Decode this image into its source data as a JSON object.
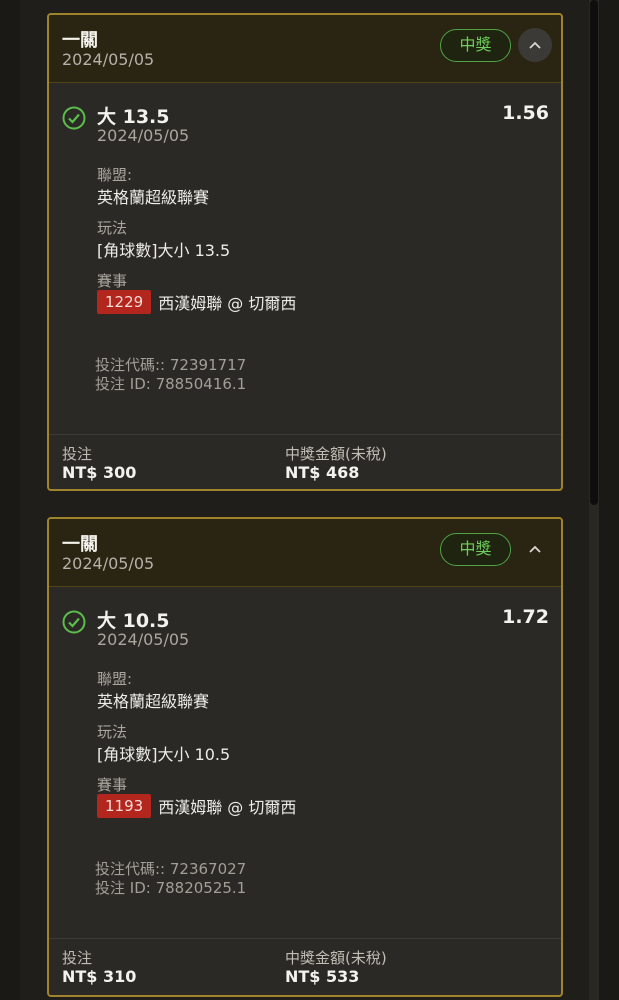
{
  "colors": {
    "card_border": "#a0842c",
    "win_green": "#6fce5c",
    "event_code_red": "#b3261e",
    "header_bg": "#2a2413"
  },
  "bets": [
    {
      "type": "一關",
      "date": "2024/05/05",
      "status": "中獎",
      "collapse_icon": "chevron-up-icon",
      "selection": "大 13.5",
      "selection_date": "2024/05/05",
      "odds": "1.56",
      "league_label": "聯盟:",
      "league": "英格蘭超級聯賽",
      "market_label": "玩法",
      "market": "[角球數]大小 13.5",
      "event_label": "賽事",
      "event_code": "1229",
      "event_name": "西漢姆聯 @ 切爾西",
      "bet_code": "投注代碼:: 72391717",
      "bet_id": "投注 ID: 78850416.1",
      "stake_label": "投注",
      "stake": "NT$ 300",
      "payout_label": "中獎金額(未稅)",
      "payout": "NT$ 468"
    },
    {
      "type": "一關",
      "date": "2024/05/05",
      "status": "中獎",
      "collapse_icon": "chevron-up-icon",
      "selection": "大 10.5",
      "selection_date": "2024/05/05",
      "odds": "1.72",
      "league_label": "聯盟:",
      "league": "英格蘭超級聯賽",
      "market_label": "玩法",
      "market": "[角球數]大小 10.5",
      "event_label": "賽事",
      "event_code": "1193",
      "event_name": "西漢姆聯 @ 切爾西",
      "bet_code": "投注代碼:: 72367027",
      "bet_id": "投注 ID: 78820525.1",
      "stake_label": "投注",
      "stake": "NT$ 310",
      "payout_label": "中獎金額(未稅)",
      "payout": "NT$ 533"
    }
  ]
}
